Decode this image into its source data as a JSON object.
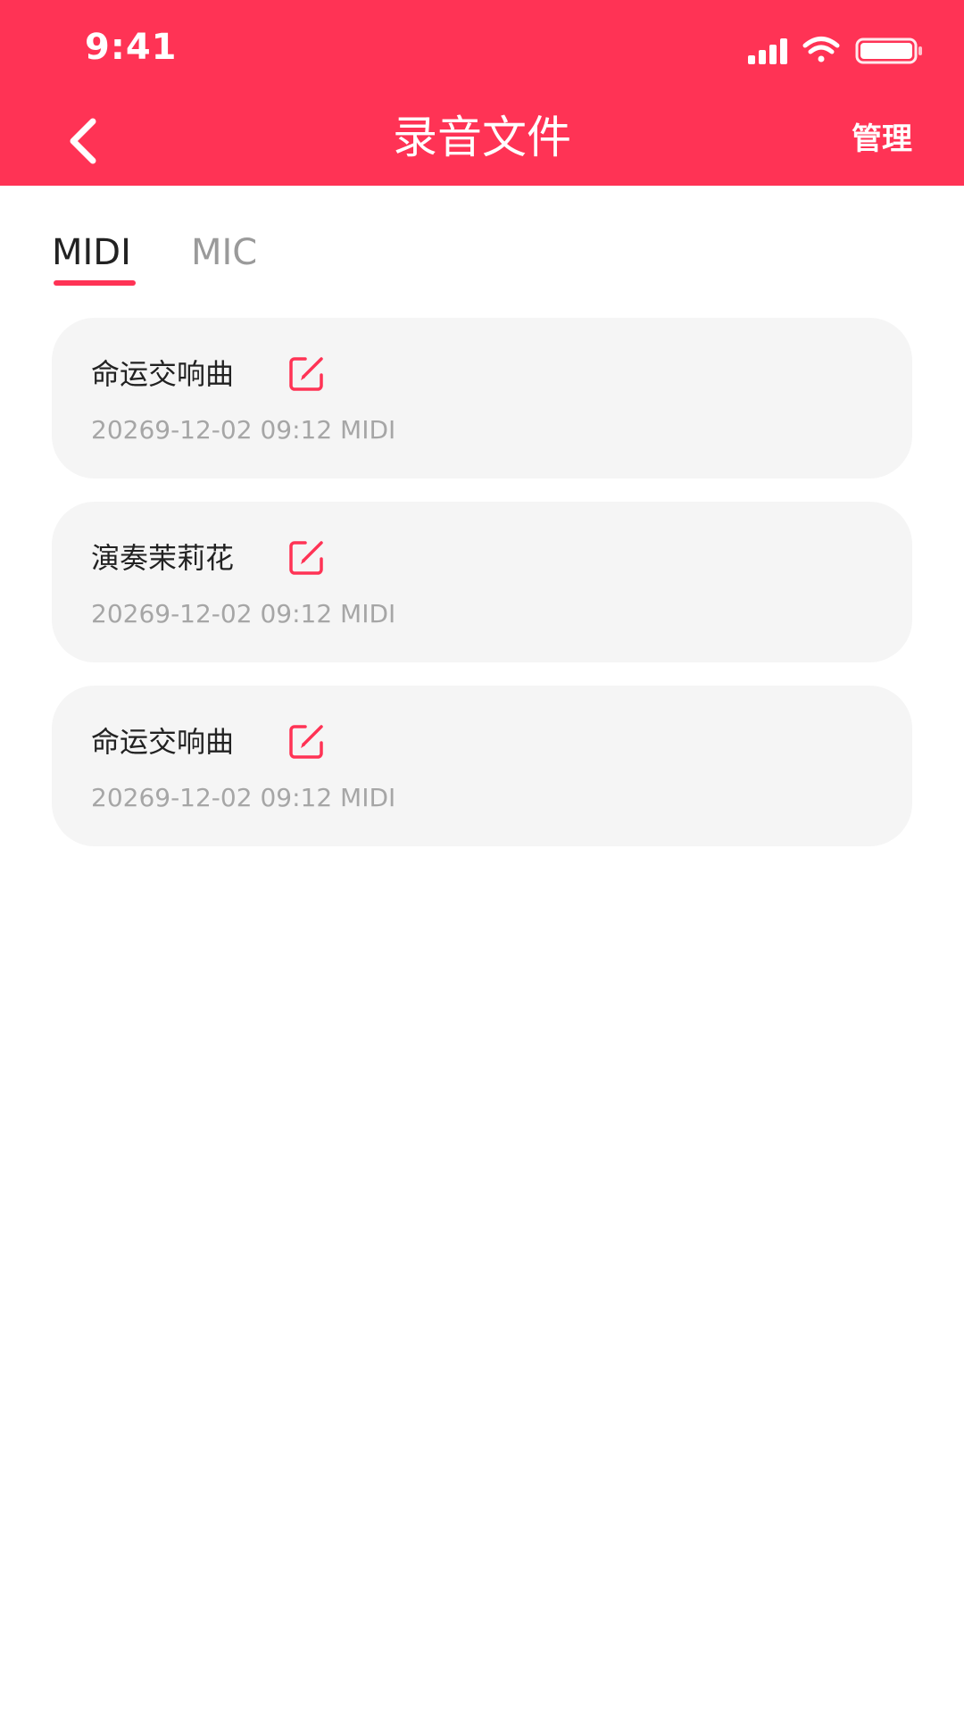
{
  "status_bar": {
    "time": "9:41"
  },
  "nav": {
    "title": "录音文件",
    "manage_label": "管理",
    "back_icon": "chevron-left-icon"
  },
  "tabs": [
    {
      "label": "MIDI",
      "active": true
    },
    {
      "label": "MIC",
      "active": false
    }
  ],
  "recordings": [
    {
      "title": "命运交响曲",
      "meta": "20269-12-02 09:12 MIDI"
    },
    {
      "title": "演奏茉莉花",
      "meta": "20269-12-02 09:12 MIDI"
    },
    {
      "title": "命运交响曲",
      "meta": "20269-12-02 09:12 MIDI"
    }
  ],
  "colors": {
    "brand": "#FF3355",
    "card_bg": "#F5F5F5",
    "text_primary": "#222222",
    "text_secondary": "#A6A6A6"
  }
}
